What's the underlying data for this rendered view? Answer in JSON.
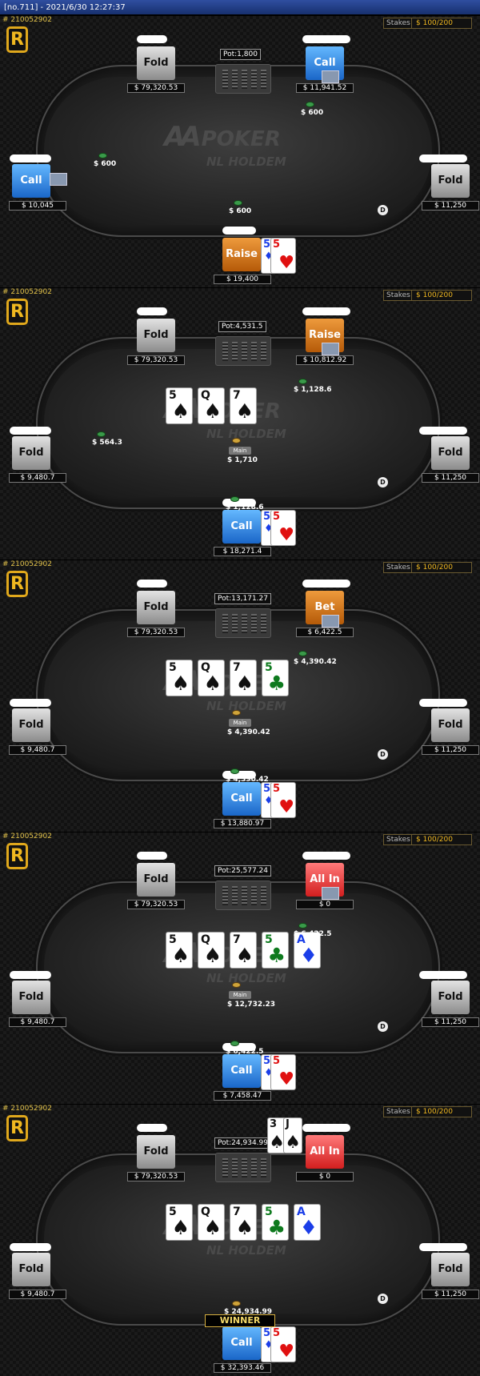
{
  "window_title": "[no.711] - 2021/6/30 12:27:37",
  "hand_id": "# 210052902",
  "stakes_label": "Stakes",
  "stakes_value": "$ 100/200",
  "logo": {
    "brand": "POKER",
    "game": "NL HOLDEM",
    "mark": "AA"
  },
  "main_label": "Main",
  "winner_label": "WINNER",
  "hero_hand": [
    {
      "rank": "5",
      "suit": "diamonds"
    },
    {
      "rank": "5",
      "suit": "hearts"
    }
  ],
  "villain_hand": [
    {
      "rank": "3",
      "suit": "spades"
    },
    {
      "rank": "J",
      "suit": "spades"
    }
  ],
  "board": [
    {
      "rank": "5",
      "suit": "spades"
    },
    {
      "rank": "Q",
      "suit": "spades"
    },
    {
      "rank": "7",
      "suit": "spades"
    },
    {
      "rank": "5",
      "suit": "clubs"
    },
    {
      "rank": "A",
      "suit": "diamonds"
    }
  ],
  "panels": [
    {
      "pot": "Pot:1,800",
      "board_count": 0,
      "seats": {
        "top_left": {
          "action": "Fold",
          "stack": "$ 79,320.53"
        },
        "top_right": {
          "action": "Call",
          "stack": "$ 11,941.52",
          "bet": "$ 600"
        },
        "left": {
          "action": "Call",
          "stack": "$ 10,045",
          "bet": "$ 600"
        },
        "right": {
          "action": "Fold",
          "stack": "$ 11,250"
        },
        "hero": {
          "action": "Raise",
          "stack": "$ 19,400",
          "bet": "$ 600"
        }
      }
    },
    {
      "pot": "Pot:4,531.5",
      "board_count": 3,
      "main_pot": "$ 1,710",
      "seats": {
        "top_left": {
          "action": "Fold",
          "stack": "$ 79,320.53"
        },
        "top_right": {
          "action": "Raise",
          "stack": "$ 10,812.92",
          "bet": "$ 1,128.6"
        },
        "left": {
          "action": "Fold",
          "stack": "$ 9,480.7",
          "bet": "$ 564.3"
        },
        "right": {
          "action": "Fold",
          "stack": "$ 11,250"
        },
        "hero": {
          "action": "Call",
          "stack": "$ 18,271.4",
          "bet": "$ 1,128.6"
        }
      }
    },
    {
      "pot": "Pot:13,171.27",
      "board_count": 4,
      "main_pot": "$ 4,390.42",
      "seats": {
        "top_left": {
          "action": "Fold",
          "stack": "$ 79,320.53"
        },
        "top_right": {
          "action": "Bet",
          "stack": "$ 6,422.5",
          "bet": "$ 4,390.42"
        },
        "left": {
          "action": "Fold",
          "stack": "$ 9,480.7"
        },
        "right": {
          "action": "Fold",
          "stack": "$ 11,250"
        },
        "hero": {
          "action": "Call",
          "stack": "$ 13,880.97",
          "bet": "$ 4,390.42"
        }
      }
    },
    {
      "pot": "Pot:25,577.24",
      "board_count": 5,
      "main_pot": "$ 12,732.23",
      "seats": {
        "top_left": {
          "action": "Fold",
          "stack": "$ 79,320.53"
        },
        "top_right": {
          "action": "All In",
          "stack": "$ 0",
          "bet": "$ 6,422.5"
        },
        "left": {
          "action": "Fold",
          "stack": "$ 9,480.7"
        },
        "right": {
          "action": "Fold",
          "stack": "$ 11,250"
        },
        "hero": {
          "action": "Call",
          "stack": "$ 7,458.47",
          "bet": "$ 6,422.5"
        }
      }
    },
    {
      "pot": "Pot:24,934.99",
      "board_count": 5,
      "win_amount": "$ 24,934.99",
      "seats": {
        "top_left": {
          "action": "Fold",
          "stack": "$ 79,320.53"
        },
        "top_right": {
          "action": "All In",
          "stack": "$ 0"
        },
        "left": {
          "action": "Fold",
          "stack": "$ 9,480.7"
        },
        "right": {
          "action": "Fold",
          "stack": "$ 11,250"
        },
        "hero": {
          "action": "Call",
          "stack": "$ 32,393.46"
        }
      }
    }
  ]
}
